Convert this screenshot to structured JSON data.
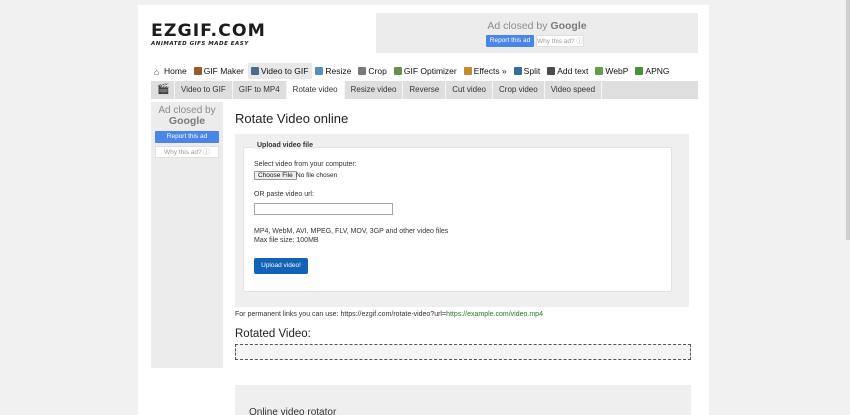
{
  "logo": {
    "main": "EZGIF.COM",
    "tagline": "ANIMATED GIFS MADE EASY"
  },
  "ad_top": {
    "closed_prefix": "Ad closed by ",
    "closed_brand": "Google",
    "report_label": "Report this ad",
    "why_label": "Why this ad? ⓘ"
  },
  "mainnav": {
    "items": [
      {
        "label": "Home",
        "icon": "home-icon"
      },
      {
        "label": "GIF Maker",
        "icon": "gif-maker-icon"
      },
      {
        "label": "Video to GIF",
        "icon": "video-icon"
      },
      {
        "label": "Resize",
        "icon": "resize-icon"
      },
      {
        "label": "Crop",
        "icon": "crop-icon"
      },
      {
        "label": "GIF Optimizer",
        "icon": "optimizer-icon"
      },
      {
        "label": "Effects »",
        "icon": "effects-icon"
      },
      {
        "label": "Split",
        "icon": "split-icon"
      },
      {
        "label": "Add text",
        "icon": "add-text-icon"
      },
      {
        "label": "WebP",
        "icon": "webp-icon"
      },
      {
        "label": "APNG",
        "icon": "apng-icon"
      }
    ]
  },
  "subnav": {
    "items": [
      {
        "label": "Video to GIF"
      },
      {
        "label": "GIF to MP4"
      },
      {
        "label": "Rotate video"
      },
      {
        "label": "Resize video"
      },
      {
        "label": "Reverse"
      },
      {
        "label": "Cut video"
      },
      {
        "label": "Crop video"
      },
      {
        "label": "Video speed"
      }
    ]
  },
  "sidebar_ad": {
    "closed_prefix": "Ad closed by",
    "closed_brand": "Google",
    "report_label": "Report this ad",
    "why_label": "Why this ad? ⓘ"
  },
  "main": {
    "title": "Rotate Video online",
    "upload": {
      "legend": "Upload video file",
      "select_label": "Select video from your computer:",
      "choose_button": "Choose File",
      "no_file": "No file chosen",
      "url_label": "OR paste video url:",
      "url_value": "",
      "formats": "MP4, WebM, AVI, MPEG, FLV, MOV, 3GP and other video files",
      "max_size": "Max file size: 100MB",
      "upload_button": "Upload video!"
    },
    "permanent_prefix": "For permanent links you can use: https://ezgif.com/rotate-video?url=",
    "permanent_link": "https://example.com/video.mp4",
    "rotated_title": "Rotated Video:",
    "info_title": "Online video rotator"
  }
}
